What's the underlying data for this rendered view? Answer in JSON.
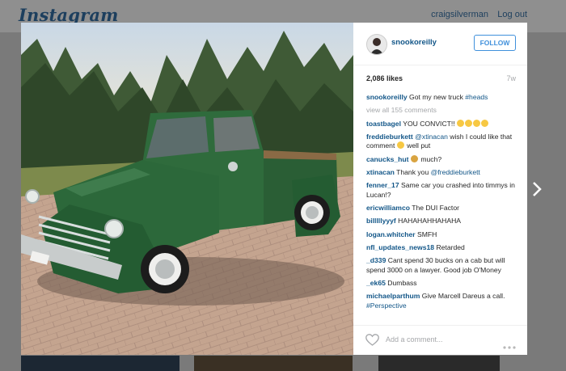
{
  "topbar": {
    "logo": "Instagram",
    "user_link": "craigsilverman",
    "logout": "Log out"
  },
  "post": {
    "username": "snookoreilly",
    "follow_label": "FOLLOW",
    "likes": "2,086 likes",
    "age": "7w",
    "caption": {
      "user": "snookoreilly",
      "text": "Got my new truck",
      "hashtag": "#heads"
    },
    "view_all": "view all 155 comments",
    "comments": [
      {
        "user": "toastbagel",
        "text": "YOU CONVICT!!"
      },
      {
        "user": "freddieburkett",
        "mention": "@xtinacan",
        "text": "wish I could like that comment",
        "text2": "well put"
      },
      {
        "user": "canucks_hut",
        "text": "much?"
      },
      {
        "user": "xtinacan",
        "text": "Thank you",
        "mention": "@freddieburkett"
      },
      {
        "user": "fenner_17",
        "text": "Same car you crashed into timmys in Lucan!?"
      },
      {
        "user": "ericwilliamco",
        "text": "The DUI Factor"
      },
      {
        "user": "billlllyyyf",
        "text": "HAHAHAHHAHAHA"
      },
      {
        "user": "logan.whitcher",
        "text": "SMFH"
      },
      {
        "user": "nfl_updates_news18",
        "text": "Retarded"
      },
      {
        "user": "_d339",
        "text": "Cant spend 30 bucks on a cab but will spend 3000 on a lawyer. Good job O'Money"
      },
      {
        "user": "_ek65",
        "text": "Dumbass"
      },
      {
        "user": "michaelparthum",
        "text": "Give Marcell Dareus a call.",
        "hashtag": "#Perspective"
      }
    ],
    "add_comment_placeholder": "Add a comment..."
  },
  "icons": {
    "heart": "heart-icon",
    "more": "more-dots-icon",
    "next": "chevron-right-icon"
  },
  "colors": {
    "link": "#125688",
    "follow": "#4090db",
    "truck": "#2f6b3c"
  }
}
